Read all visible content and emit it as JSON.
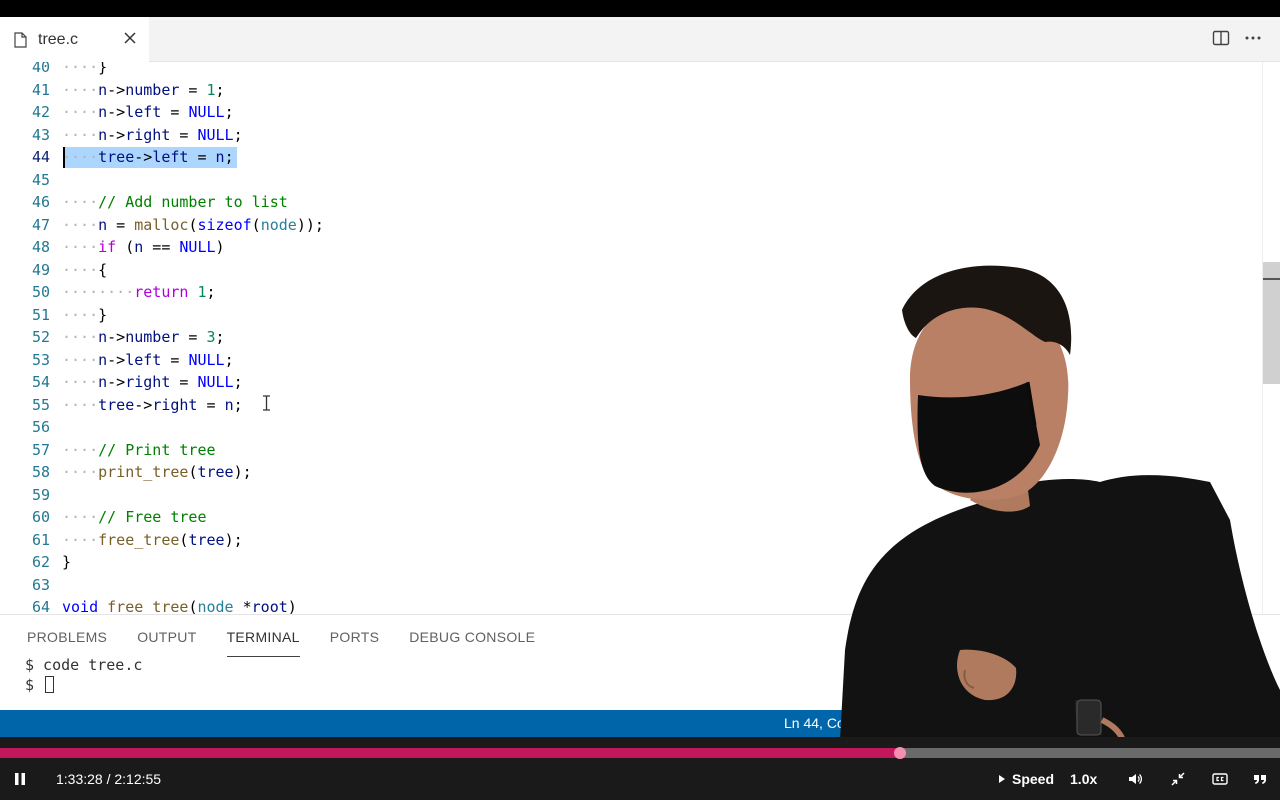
{
  "tab": {
    "filename": "tree.c"
  },
  "editor": {
    "lines": [
      {
        "n": "40",
        "tokens": [
          [
            "ws",
            "····"
          ],
          [
            "",
            "}"
          ]
        ]
      },
      {
        "n": "41",
        "tokens": [
          [
            "ws",
            "····"
          ],
          [
            "id",
            "n"
          ],
          [
            "",
            "->"
          ],
          [
            "id",
            "number"
          ],
          [
            "",
            " = "
          ],
          [
            "num",
            "1"
          ],
          [
            "",
            ";"
          ]
        ]
      },
      {
        "n": "42",
        "tokens": [
          [
            "ws",
            "····"
          ],
          [
            "id",
            "n"
          ],
          [
            "",
            "->"
          ],
          [
            "id",
            "left"
          ],
          [
            "",
            " = "
          ],
          [
            "cst",
            "NULL"
          ],
          [
            "",
            ";"
          ]
        ]
      },
      {
        "n": "43",
        "tokens": [
          [
            "ws",
            "····"
          ],
          [
            "id",
            "n"
          ],
          [
            "",
            "->"
          ],
          [
            "id",
            "right"
          ],
          [
            "",
            " = "
          ],
          [
            "cst",
            "NULL"
          ],
          [
            "",
            ";"
          ]
        ]
      },
      {
        "n": "44",
        "tokens": [
          [
            "ws",
            "····"
          ],
          [
            "id",
            "tree"
          ],
          [
            "",
            "->"
          ],
          [
            "id",
            "left"
          ],
          [
            "",
            " = "
          ],
          [
            "id",
            "n"
          ],
          [
            "",
            ";"
          ]
        ]
      },
      {
        "n": "45",
        "tokens": []
      },
      {
        "n": "46",
        "tokens": [
          [
            "ws",
            "····"
          ],
          [
            "cm",
            "// Add number to list"
          ]
        ]
      },
      {
        "n": "47",
        "tokens": [
          [
            "ws",
            "····"
          ],
          [
            "id",
            "n"
          ],
          [
            "",
            " = "
          ],
          [
            "fn",
            "malloc"
          ],
          [
            "",
            "("
          ],
          [
            "kw",
            "sizeof"
          ],
          [
            "",
            "("
          ],
          [
            "ty",
            "node"
          ],
          [
            "",
            "));"
          ]
        ]
      },
      {
        "n": "48",
        "tokens": [
          [
            "ws",
            "····"
          ],
          [
            "ctl",
            "if"
          ],
          [
            "",
            " ("
          ],
          [
            "id",
            "n"
          ],
          [
            "",
            " == "
          ],
          [
            "cst",
            "NULL"
          ],
          [
            "",
            ")"
          ]
        ]
      },
      {
        "n": "49",
        "tokens": [
          [
            "ws",
            "····"
          ],
          [
            "",
            "{"
          ]
        ]
      },
      {
        "n": "50",
        "tokens": [
          [
            "ws",
            "········"
          ],
          [
            "ctl",
            "return"
          ],
          [
            "",
            " "
          ],
          [
            "num",
            "1"
          ],
          [
            "",
            ";"
          ]
        ]
      },
      {
        "n": "51",
        "tokens": [
          [
            "ws",
            "····"
          ],
          [
            "",
            "}"
          ]
        ]
      },
      {
        "n": "52",
        "tokens": [
          [
            "ws",
            "····"
          ],
          [
            "id",
            "n"
          ],
          [
            "",
            "->"
          ],
          [
            "id",
            "number"
          ],
          [
            "",
            " = "
          ],
          [
            "num",
            "3"
          ],
          [
            "",
            ";"
          ]
        ]
      },
      {
        "n": "53",
        "tokens": [
          [
            "ws",
            "····"
          ],
          [
            "id",
            "n"
          ],
          [
            "",
            "->"
          ],
          [
            "id",
            "left"
          ],
          [
            "",
            " = "
          ],
          [
            "cst",
            "NULL"
          ],
          [
            "",
            ";"
          ]
        ]
      },
      {
        "n": "54",
        "tokens": [
          [
            "ws",
            "····"
          ],
          [
            "id",
            "n"
          ],
          [
            "",
            "->"
          ],
          [
            "id",
            "right"
          ],
          [
            "",
            " = "
          ],
          [
            "cst",
            "NULL"
          ],
          [
            "",
            ";"
          ]
        ]
      },
      {
        "n": "55",
        "tokens": [
          [
            "ws",
            "····"
          ],
          [
            "id",
            "tree"
          ],
          [
            "",
            "->"
          ],
          [
            "id",
            "right"
          ],
          [
            "",
            " = "
          ],
          [
            "id",
            "n"
          ],
          [
            "",
            ";"
          ]
        ]
      },
      {
        "n": "56",
        "tokens": []
      },
      {
        "n": "57",
        "tokens": [
          [
            "ws",
            "····"
          ],
          [
            "cm",
            "// Print tree"
          ]
        ]
      },
      {
        "n": "58",
        "tokens": [
          [
            "ws",
            "····"
          ],
          [
            "fn",
            "print_tree"
          ],
          [
            "",
            "("
          ],
          [
            "id",
            "tree"
          ],
          [
            "",
            ");"
          ]
        ]
      },
      {
        "n": "59",
        "tokens": []
      },
      {
        "n": "60",
        "tokens": [
          [
            "ws",
            "····"
          ],
          [
            "cm",
            "// Free tree"
          ]
        ]
      },
      {
        "n": "61",
        "tokens": [
          [
            "ws",
            "····"
          ],
          [
            "fn",
            "free_tree"
          ],
          [
            "",
            "("
          ],
          [
            "id",
            "tree"
          ],
          [
            "",
            ");"
          ]
        ]
      },
      {
        "n": "62",
        "tokens": [
          [
            "",
            "}"
          ]
        ]
      },
      {
        "n": "63",
        "tokens": []
      },
      {
        "n": "64",
        "tokens": [
          [
            "kw",
            "void"
          ],
          [
            "",
            " "
          ],
          [
            "fn",
            "free_tree"
          ],
          [
            "",
            "("
          ],
          [
            "ty",
            "node"
          ],
          [
            "",
            " *"
          ],
          [
            "id",
            "root"
          ],
          [
            "",
            ")"
          ]
        ]
      }
    ],
    "active_line": "44",
    "selected_line": "44"
  },
  "panel": {
    "tabs": [
      "PROBLEMS",
      "OUTPUT",
      "TERMINAL",
      "PORTS",
      "DEBUG CONSOLE"
    ],
    "active_tab": "TERMINAL",
    "terminal": {
      "line1": "$ code tree.c",
      "prompt": "$ "
    }
  },
  "status": {
    "position": "Ln 44, Co"
  },
  "video": {
    "time": "1:33:28 / 2:12:55",
    "speed_label": "Speed",
    "speed_value": "1.0x",
    "progress": 0.7033
  },
  "colors": {
    "status_bar": "#0065a9",
    "progress_fill": "#c2185b",
    "selection": "#add6ff"
  }
}
